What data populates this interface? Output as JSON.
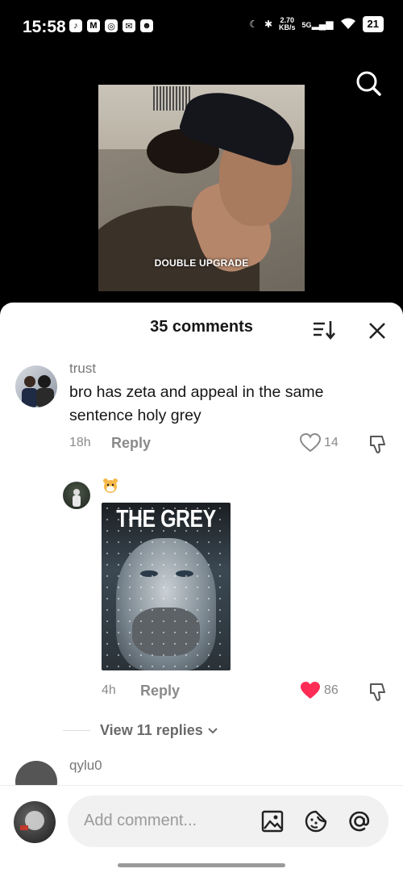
{
  "status_bar": {
    "time": "15:58",
    "app_icons": [
      "tiktok-icon",
      "gmail-icon",
      "app-icon",
      "messenger-icon",
      "discord-icon"
    ],
    "net_speed": "2.70",
    "net_unit": "KB/s",
    "net_type": "5G",
    "battery": "21"
  },
  "video": {
    "caption": "DOUBLE UPGRADE"
  },
  "comments_panel": {
    "title": "35 comments"
  },
  "comments": [
    {
      "username": "trust",
      "text": "bro has zeta and appeal in the same sentence holy grey",
      "time": "18h",
      "reply_label": "Reply",
      "likes": "14",
      "liked": false
    },
    {
      "username": "",
      "text": "",
      "image_title": "THE GREY",
      "time": "4h",
      "reply_label": "Reply",
      "likes": "86",
      "liked": true
    }
  ],
  "view_replies": "View 11 replies",
  "next_comment": {
    "username": "qylu0"
  },
  "composer": {
    "placeholder": "Add comment..."
  },
  "colors": {
    "like_active": "#fe2c55",
    "text_primary": "#161616",
    "text_secondary": "#8a8a8a"
  }
}
